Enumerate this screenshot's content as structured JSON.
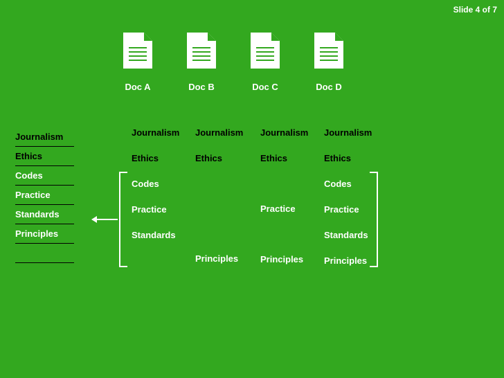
{
  "slide_counter": {
    "prefix": "Slide ",
    "current": "4",
    "of": " of ",
    "total": "7"
  },
  "docs": [
    {
      "label": "Doc A"
    },
    {
      "label": "Doc B"
    },
    {
      "label": "Doc C"
    },
    {
      "label": "Doc D"
    }
  ],
  "master": [
    {
      "text": "Journalism",
      "tone": "dark"
    },
    {
      "text": "Ethics",
      "tone": "dark"
    },
    {
      "text": "Codes",
      "tone": "white"
    },
    {
      "text": "Practice",
      "tone": "white"
    },
    {
      "text": "Standards",
      "tone": "white"
    },
    {
      "text": "Principles",
      "tone": "white"
    }
  ],
  "columns": {
    "A": [
      "Journalism",
      "Ethics",
      "Codes",
      "Practice",
      "Standards",
      ""
    ],
    "B": [
      "Journalism",
      "Ethics",
      "",
      "",
      "",
      "Principles"
    ],
    "C": [
      "Journalism",
      "Ethics",
      "",
      "Practice",
      "",
      "Principles"
    ],
    "D": [
      "Journalism",
      "Ethics",
      "Codes",
      "Practice",
      "Standards",
      "Principles"
    ]
  },
  "dark_terms": [
    "Journalism",
    "Ethics"
  ]
}
